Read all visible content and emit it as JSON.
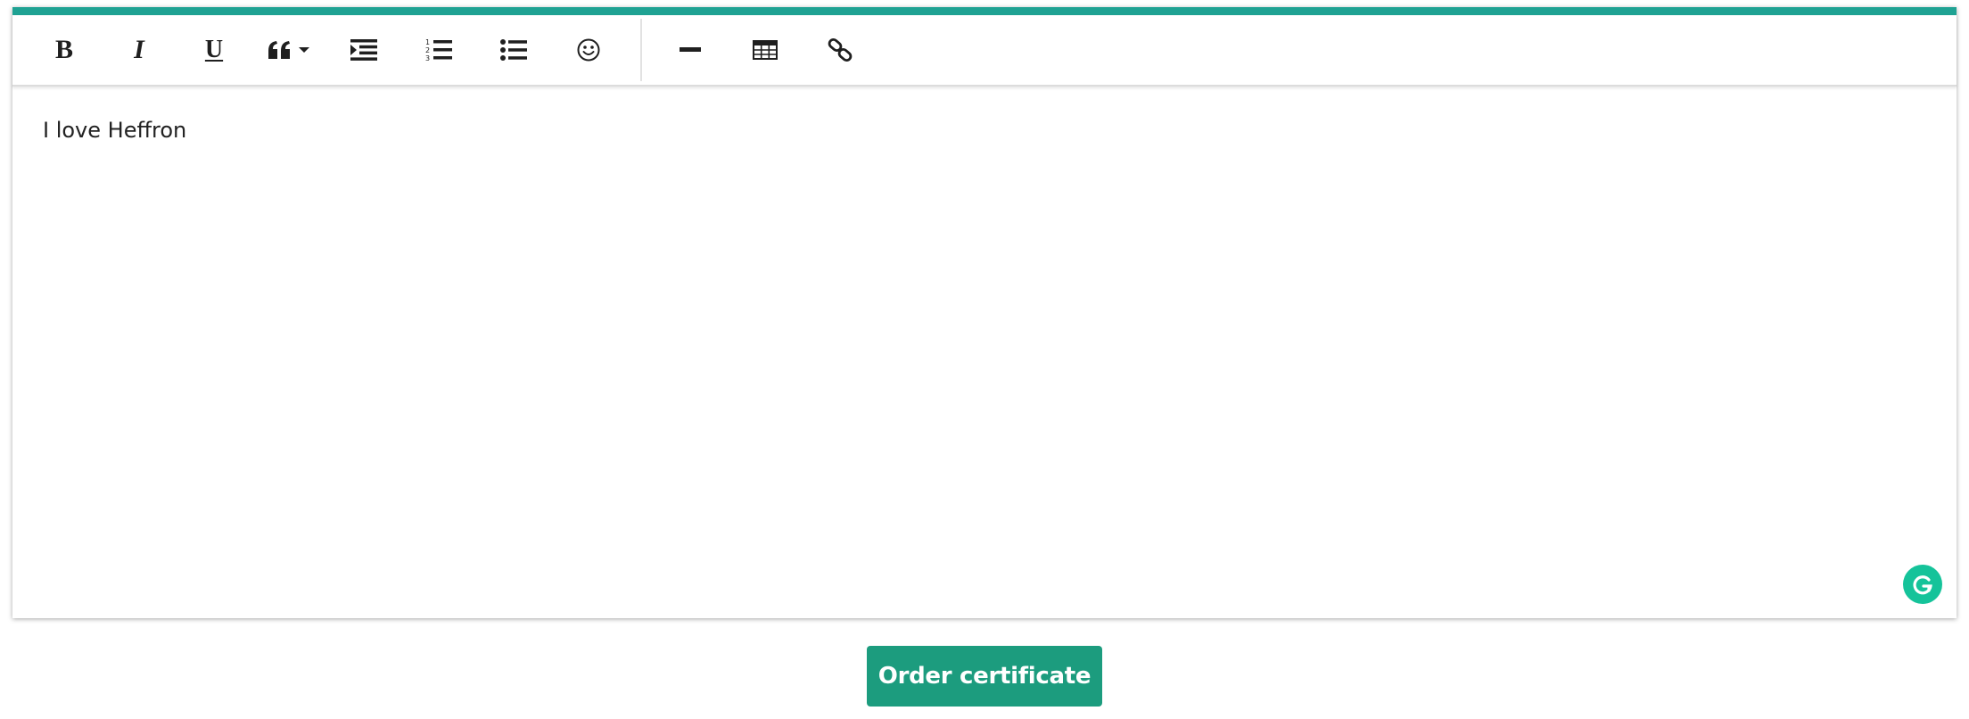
{
  "editor": {
    "accent_color": "#1fa293",
    "toolbar": {
      "bold_label": "B",
      "italic_label": "I",
      "underline_label": "U",
      "items": [
        {
          "name": "bold",
          "icon": "bold-icon"
        },
        {
          "name": "italic",
          "icon": "italic-icon"
        },
        {
          "name": "underline",
          "icon": "underline-icon"
        },
        {
          "name": "blockquote",
          "icon": "quote-icon"
        },
        {
          "name": "indent",
          "icon": "indent-icon"
        },
        {
          "name": "ordered-list",
          "icon": "ordered-list-icon"
        },
        {
          "name": "unordered-list",
          "icon": "unordered-list-icon"
        },
        {
          "name": "emoji",
          "icon": "smiley-icon"
        },
        {
          "name": "horizontal-rule",
          "icon": "horizontal-rule-icon"
        },
        {
          "name": "table",
          "icon": "table-icon"
        },
        {
          "name": "link",
          "icon": "link-icon"
        }
      ]
    },
    "content": "I love Heffron",
    "grammarly_color": "#15c39a"
  },
  "actions": {
    "order_label": "Order certificate",
    "order_color": "#1c9c7e"
  }
}
